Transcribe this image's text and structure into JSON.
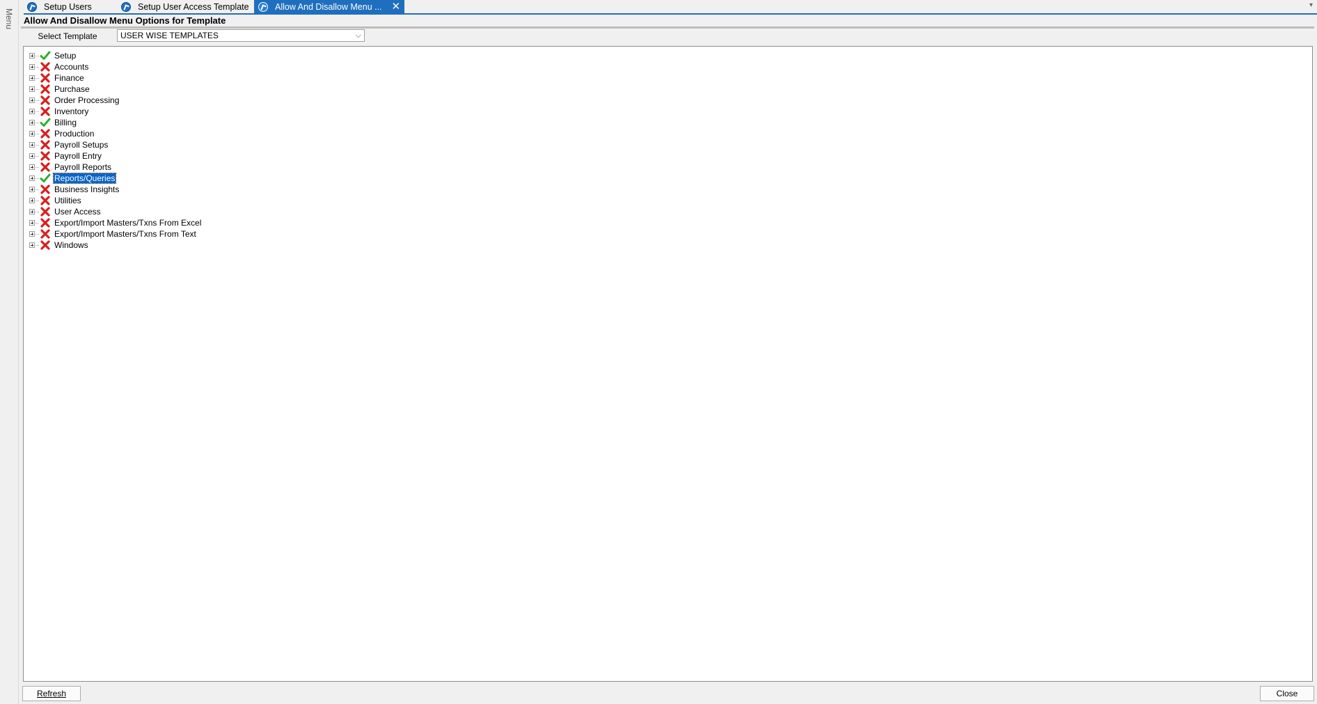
{
  "sidebar": {
    "label": "Menu"
  },
  "tabs": [
    {
      "label": "Setup Users",
      "active": false
    },
    {
      "label": "Setup User Access Template",
      "active": false
    },
    {
      "label": "Allow And Disallow Menu ...",
      "active": true
    }
  ],
  "panel": {
    "title": "Allow And Disallow Menu Options for Template"
  },
  "template": {
    "label": "Select Template",
    "value": "USER WISE TEMPLATES"
  },
  "tree": {
    "items": [
      {
        "label": "Setup",
        "allowed": true
      },
      {
        "label": "Accounts",
        "allowed": false
      },
      {
        "label": "Finance",
        "allowed": false
      },
      {
        "label": "Purchase",
        "allowed": false
      },
      {
        "label": "Order Processing",
        "allowed": false
      },
      {
        "label": "Inventory",
        "allowed": false
      },
      {
        "label": "Billing",
        "allowed": true
      },
      {
        "label": "Production",
        "allowed": false
      },
      {
        "label": "Payroll Setups",
        "allowed": false
      },
      {
        "label": "Payroll Entry",
        "allowed": false
      },
      {
        "label": "Payroll Reports",
        "allowed": false
      },
      {
        "label": "Reports/Queries",
        "allowed": true,
        "selected": true
      },
      {
        "label": "Business Insights",
        "allowed": false
      },
      {
        "label": "Utilities",
        "allowed": false
      },
      {
        "label": "User Access",
        "allowed": false
      },
      {
        "label": "Export/Import Masters/Txns From Excel",
        "allowed": false
      },
      {
        "label": "Export/Import Masters/Txns From Text",
        "allowed": false
      },
      {
        "label": "Windows",
        "allowed": false
      }
    ]
  },
  "buttons": {
    "refresh": "Refresh",
    "close": "Close"
  },
  "colors": {
    "accent": "#1f6fbf",
    "allowed": "#2fae2f",
    "disallowed": "#d91e1e",
    "selection": "#0a64c8"
  }
}
